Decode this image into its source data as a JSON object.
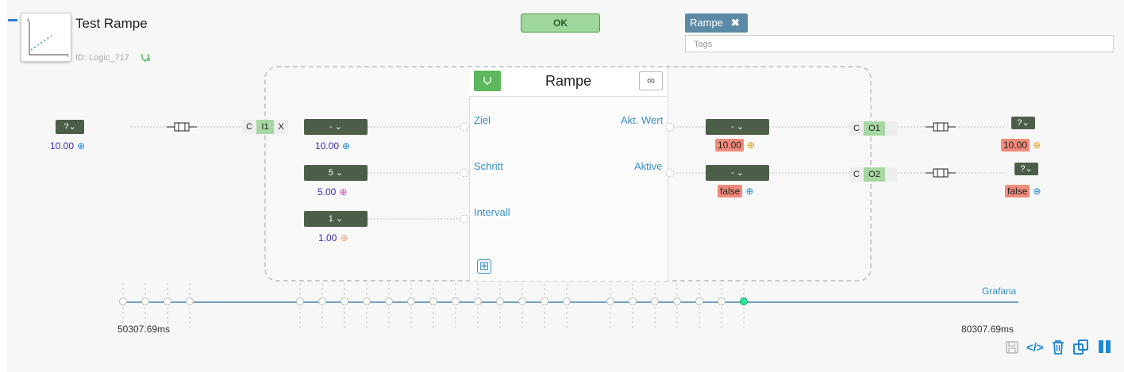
{
  "header": {
    "title": "Test Rampe",
    "id_text": "ID: Logic_717",
    "ok_label": "OK"
  },
  "tags": {
    "chips": [
      {
        "label": "Rampe",
        "remove": "✖"
      }
    ],
    "placeholder": "Tags"
  },
  "block": {
    "title": "Rampe",
    "inputs": [
      "Ziel",
      "Schritt",
      "Intervall"
    ],
    "outputs": [
      "Akt. Wert",
      "Aktive"
    ],
    "add_symbol": "⊞",
    "loop_symbol": "∞"
  },
  "source": {
    "dropdown": "?⌄",
    "value": "10.00"
  },
  "input_port": {
    "c": "C",
    "name": "I1",
    "x": "X"
  },
  "params": [
    {
      "dropdown": "- ⌄",
      "value": "10.00"
    },
    {
      "dropdown": "5 ⌄",
      "value": "5.00"
    },
    {
      "dropdown": "1 ⌄",
      "value": "1.00"
    }
  ],
  "outputs": [
    {
      "dropdown": "- ⌄",
      "value": "10.00",
      "port_c": "C",
      "port": "O1",
      "target_dropdown": "?⌄",
      "target_value": "10.00"
    },
    {
      "dropdown": "- ⌄",
      "value": "false",
      "port_c": "C",
      "port": "O2",
      "target_dropdown": "?⌄",
      "target_value": "false"
    }
  ],
  "timeline": {
    "start": "50307.69ms",
    "end": "80307.69ms",
    "link": "Grafana"
  },
  "toolbar": {
    "save": "💾",
    "code": "</>",
    "delete": "🗑",
    "copy": "⧉",
    "pause": "❚❚"
  },
  "colors": {
    "accent": "#3a8fc0",
    "dropdown": "#4c5e48",
    "highlight": "#f28b7a",
    "ok": "#9ed69b"
  }
}
